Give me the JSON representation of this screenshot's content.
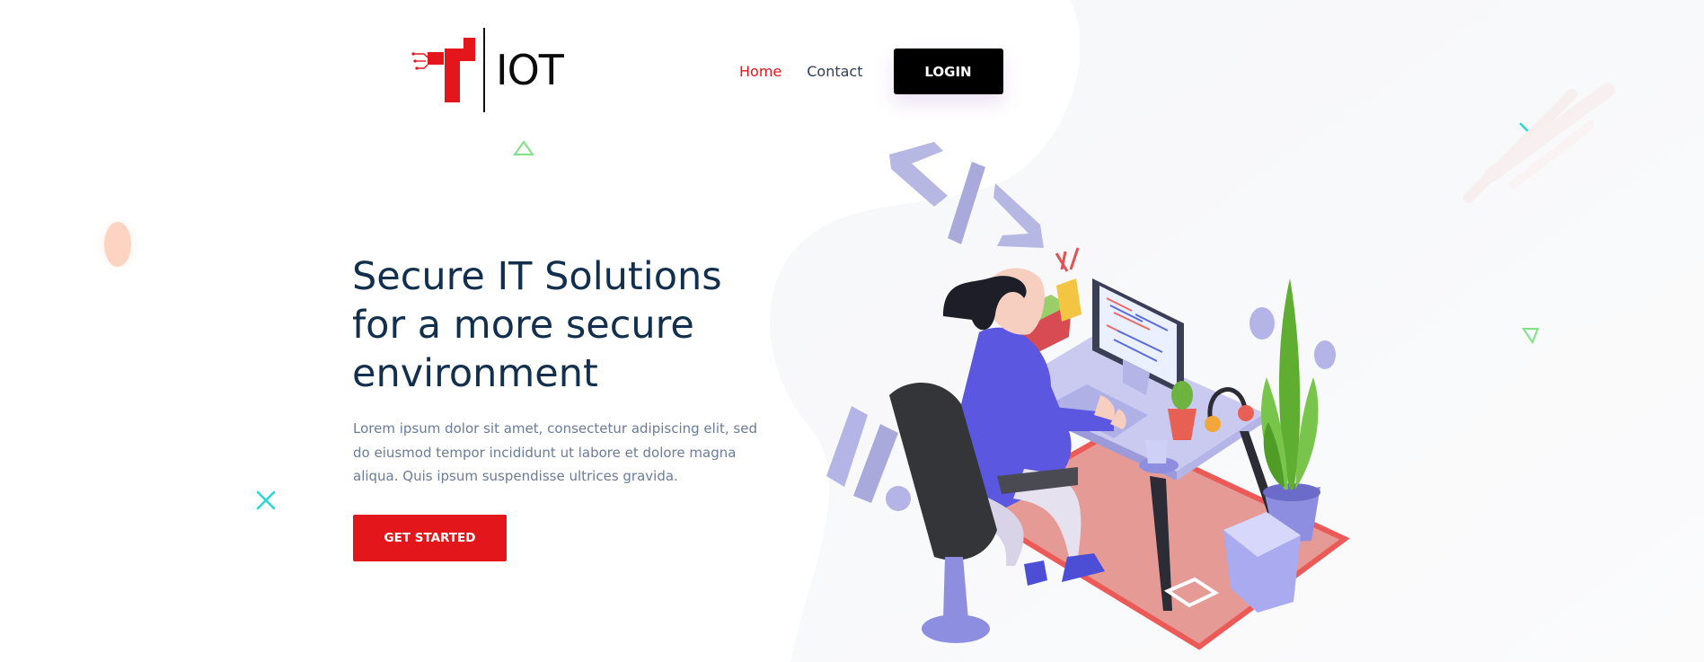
{
  "brand": {
    "name": "IOT",
    "accent_color": "#e3161b",
    "dark_color": "#12304d"
  },
  "nav": {
    "items": [
      {
        "label": "Home",
        "active": true
      },
      {
        "label": "Contact",
        "active": false
      }
    ],
    "login_label": "LOGIN"
  },
  "hero": {
    "title": "Secure IT Solutions for a more secure environment",
    "body": "Lorem ipsum dolor sit amet, consectetur adipiscing elit, sed do eiusmod tempor incididunt ut labore et dolore magna aliqua. Quis ipsum suspendisse ultrices gravida.",
    "cta_label": "GET STARTED"
  },
  "icons": {
    "logo": "iot-logo-icon",
    "cross_teal": "cross-icon",
    "triangle_green": "triangle-icon",
    "code": "code-brackets-icon"
  }
}
